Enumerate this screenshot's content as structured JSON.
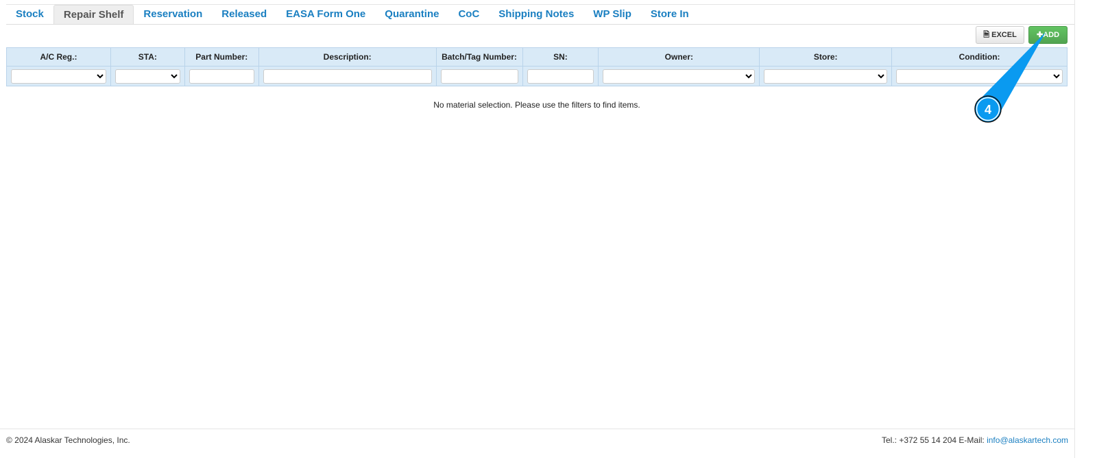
{
  "tabs": [
    "Stock",
    "Repair Shelf",
    "Reservation",
    "Released",
    "EASA Form One",
    "Quarantine",
    "CoC",
    "Shipping Notes",
    "WP Slip",
    "Store In"
  ],
  "active_tab": "Repair Shelf",
  "toolbar": {
    "excel_label": "EXCEL",
    "add_label": "ADD"
  },
  "table": {
    "columns": [
      {
        "label": "A/C Reg.:",
        "filter": "select"
      },
      {
        "label": "STA:",
        "filter": "select"
      },
      {
        "label": "Part Number:",
        "filter": "input"
      },
      {
        "label": "Description:",
        "filter": "input"
      },
      {
        "label": "Batch/Tag Number:",
        "filter": "input"
      },
      {
        "label": "SN:",
        "filter": "input"
      },
      {
        "label": "Owner:",
        "filter": "select"
      },
      {
        "label": "Store:",
        "filter": "select"
      },
      {
        "label": "Condition:",
        "filter": "select"
      }
    ]
  },
  "message": "No material selection. Please use the filters to find items.",
  "callout": {
    "number": "4",
    "color": "#0a9af0"
  },
  "footer": {
    "copyright": "© 2024 Alaskar Technologies, Inc.",
    "contact": "Tel.: +372 55 14 204 E-Mail:",
    "email": "info@alaskartech.com"
  }
}
